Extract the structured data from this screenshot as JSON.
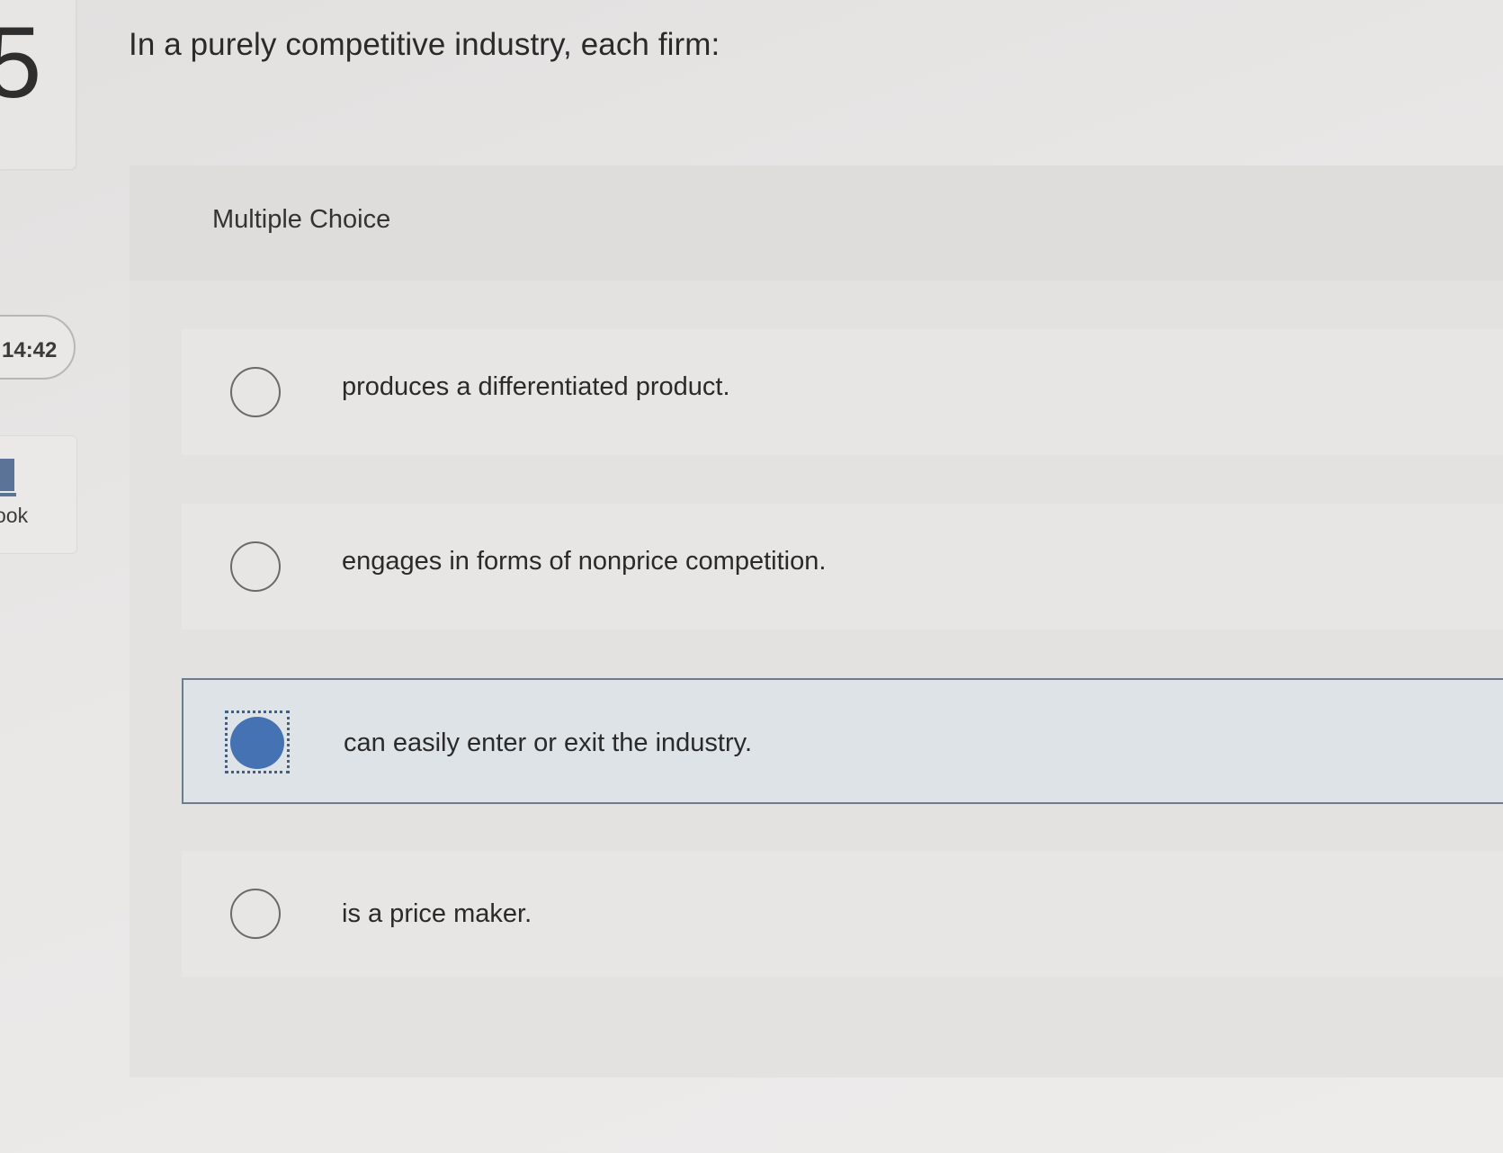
{
  "sidebar": {
    "question_number": "5",
    "timer": ":14:42",
    "ebook_label": "ook"
  },
  "question": {
    "text": "In a purely competitive industry, each firm:"
  },
  "choices": {
    "header": "Multiple Choice",
    "options": [
      {
        "label": "produces a differentiated product.",
        "selected": false
      },
      {
        "label": "engages in forms of nonprice competition.",
        "selected": false
      },
      {
        "label": "can easily enter or exit the industry.",
        "selected": true
      },
      {
        "label": "is a price maker.",
        "selected": false
      }
    ],
    "selected_color": "#4472b3"
  }
}
